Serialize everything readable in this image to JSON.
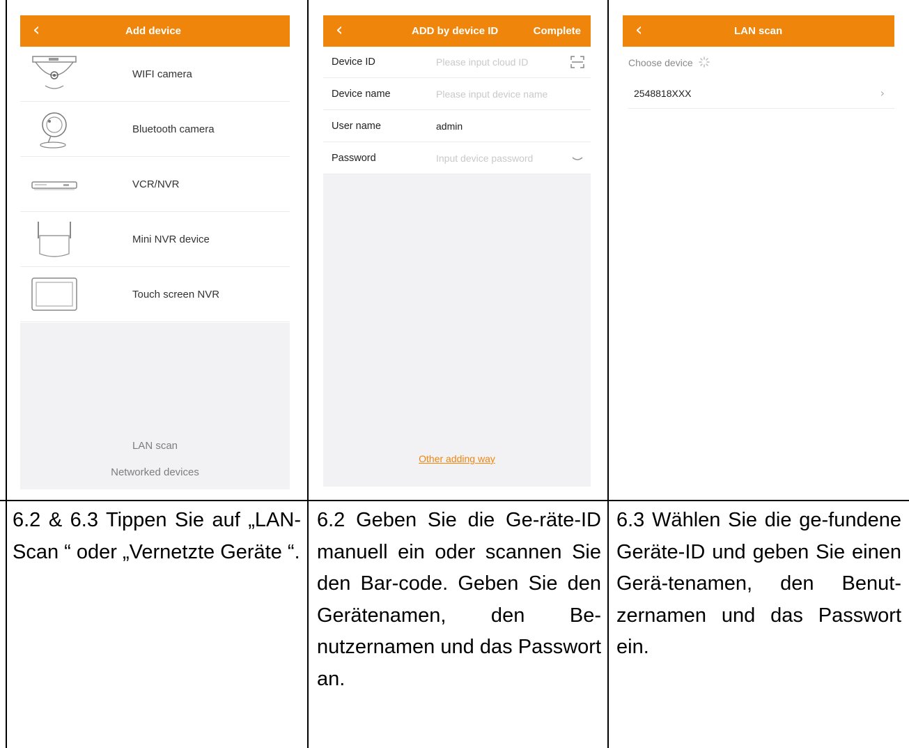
{
  "panels": [
    {
      "header": {
        "back_icon": "chevron-left-icon",
        "title": "Add device"
      },
      "devices": [
        {
          "icon": "wifi-camera-icon",
          "label": "WIFI camera"
        },
        {
          "icon": "bluetooth-camera-icon",
          "label": "Bluetooth camera"
        },
        {
          "icon": "vcr-nvr-icon",
          "label": "VCR/NVR"
        },
        {
          "icon": "mini-nvr-icon",
          "label": "Mini NVR device"
        },
        {
          "icon": "touch-screen-nvr-icon",
          "label": "Touch screen NVR"
        }
      ],
      "lan_scan": "LAN scan",
      "networked_devices": "Networked devices"
    },
    {
      "header": {
        "back_icon": "chevron-left-icon",
        "title": "ADD by device ID",
        "right_action": "Complete"
      },
      "fields": [
        {
          "label": "Device ID",
          "placeholder": "Please input cloud ID",
          "value": "",
          "side_icon": "scan-icon"
        },
        {
          "label": "Device name",
          "placeholder": "Please input device name",
          "value": ""
        },
        {
          "label": "User name",
          "placeholder": "",
          "value": "admin"
        },
        {
          "label": "Password",
          "placeholder": "Input device password",
          "value": "",
          "side_icon": "eye-closed-icon"
        }
      ],
      "other_way": "Other adding way"
    },
    {
      "header": {
        "back_icon": "chevron-left-icon",
        "title": "LAN scan"
      },
      "choose_label": "Choose device",
      "loading_icon": "spinner-icon",
      "devices": [
        {
          "id": "2548818XXX",
          "icon": "chevron-right-icon"
        }
      ]
    }
  ],
  "captions": [
    "6.2 & 6.3 Tippen Sie auf „LAN-Scan “ oder „Vernetzte Geräte “.",
    "6.2 Geben Sie die Ge-räte-ID manuell ein oder scannen Sie den Bar-code. Geben Sie den Gerätenamen, den Be-nutzernamen und das Passwort an.",
    "6.3 Wählen Sie die ge-fundene Geräte-ID und geben Sie einen Gerä-tenamen, den Benut-zernamen und das Passwort ein."
  ],
  "colors": {
    "accent": "#f0850c",
    "link": "#f0850c",
    "background_gray": "#f2f2f4"
  }
}
